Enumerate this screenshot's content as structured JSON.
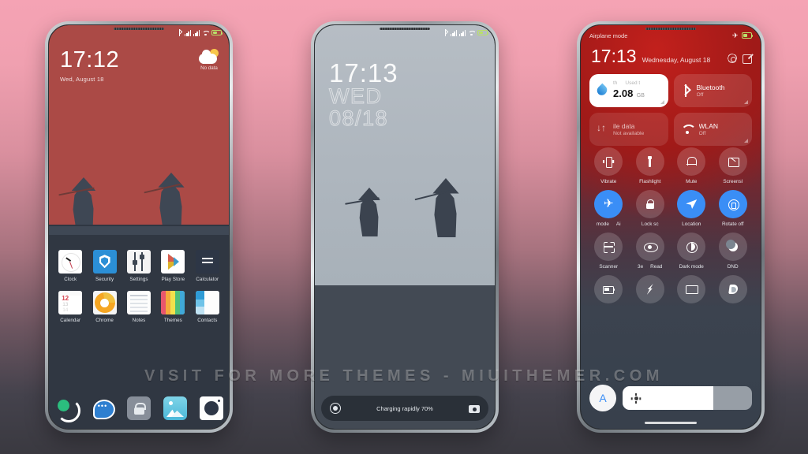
{
  "background": {
    "top_color": "#f5a3b4",
    "bottom_color": "#3a3940"
  },
  "watermark": {
    "text": "VISIT  FOR  MORE  THEMES  -  MIUITHEMER.COM"
  },
  "phone1": {
    "name": "home-screen",
    "statusbar": {
      "icons": [
        "bluetooth-icon",
        "signal-icon",
        "signal-icon",
        "wifi-icon",
        "battery-icon"
      ]
    },
    "clock_widget": {
      "time": "17:12",
      "date": "Wed, August 18"
    },
    "weather_widget": {
      "icon": "partly-cloudy-icon",
      "label": "No data"
    },
    "apps": [
      {
        "label": "Clock",
        "icon": "clock-icon"
      },
      {
        "label": "Security",
        "icon": "shield-icon"
      },
      {
        "label": "Settings",
        "icon": "sliders-icon"
      },
      {
        "label": "Play Store",
        "icon": "play-store-icon"
      },
      {
        "label": "Calculator",
        "icon": "calculator-icon"
      },
      {
        "label": "Calendar",
        "icon": "calendar-icon"
      },
      {
        "label": "Chrome",
        "icon": "chrome-icon"
      },
      {
        "label": "Notes",
        "icon": "notes-icon"
      },
      {
        "label": "Themes",
        "icon": "themes-icon"
      },
      {
        "label": "Contacts",
        "icon": "contacts-icon"
      }
    ],
    "calendar_icon": {
      "day": "12",
      "next1": "13",
      "next2": "14"
    },
    "dock": [
      {
        "name": "phone-app",
        "icon": "phone-icon"
      },
      {
        "name": "messaging-app",
        "icon": "message-icon"
      },
      {
        "name": "lock-app",
        "icon": "lock-icon"
      },
      {
        "name": "gallery-app",
        "icon": "gallery-icon"
      },
      {
        "name": "camera-app",
        "icon": "camera-icon"
      }
    ]
  },
  "phone2": {
    "name": "lock-screen",
    "statusbar": {
      "icons": [
        "bluetooth-icon",
        "signal-icon",
        "signal-icon",
        "wifi-icon",
        "battery-icon"
      ]
    },
    "lock_clock": {
      "time": "17:13",
      "weekday": "WED",
      "date": "08/18"
    },
    "bottom_bar": {
      "left_icon": "flashlight-icon",
      "status_text": "Charging rapidly 70%",
      "right_icon": "camera-icon"
    }
  },
  "phone3": {
    "name": "control-center",
    "statusbar": {
      "left_text": "Airplane mode",
      "icons": [
        "airplane-icon",
        "battery-icon"
      ]
    },
    "header": {
      "time": "17:13",
      "date": "Wednesday, August 18",
      "settings_icon": "gear-icon",
      "edit_icon": "edit-icon"
    },
    "big_tiles": [
      {
        "id": "data-usage",
        "state": "on",
        "icon": "water-drop-icon",
        "used_label": "Used t",
        "mini_label": "th",
        "value": "2.08",
        "unit": "GB"
      },
      {
        "id": "bluetooth",
        "state": "off",
        "icon": "bluetooth-icon",
        "title": "Bluetooth",
        "subtitle": "Off"
      },
      {
        "id": "mobile-data",
        "state": "disabled",
        "icon": "data-transfer-icon",
        "title": "ile data",
        "subtitle": "Not available"
      },
      {
        "id": "wlan",
        "state": "off",
        "icon": "wifi-icon",
        "title": "WLAN",
        "subtitle": "Off"
      }
    ],
    "toggles": [
      {
        "label": "Vibrate",
        "icon": "vibrate-icon",
        "active": false
      },
      {
        "label": "Flashlight",
        "icon": "flashlight-icon",
        "active": false
      },
      {
        "label": "Mute",
        "icon": "bell-icon",
        "active": false
      },
      {
        "label": "Screensl",
        "icon": "screenshot-icon",
        "active": false
      },
      {
        "label": "mode",
        "label2": "Ai",
        "icon": "airplane-icon",
        "active": true
      },
      {
        "label": "Lock sc",
        "icon": "lock-icon",
        "active": false
      },
      {
        "label": "Location",
        "icon": "location-icon",
        "active": true
      },
      {
        "label": "Rotate off",
        "icon": "rotate-icon",
        "active": true
      },
      {
        "label": "Scanner",
        "icon": "scanner-icon",
        "active": false
      },
      {
        "label": "3e",
        "label2": "Read",
        "icon": "eye-icon",
        "active": false
      },
      {
        "label": "Dark mode",
        "icon": "contrast-circle-icon",
        "active": false
      },
      {
        "label": "DND",
        "icon": "moon-icon",
        "active": false
      },
      {
        "label": "",
        "icon": "battery-saver-icon",
        "active": false
      },
      {
        "label": "",
        "icon": "lightning-icon",
        "active": false
      },
      {
        "label": "",
        "icon": "cast-icon",
        "active": false
      },
      {
        "label": "",
        "icon": "reading-mode-icon",
        "active": false
      }
    ],
    "brightness": {
      "auto_label": "A",
      "sun_icon": "brightness-icon",
      "level_percent": 70
    }
  }
}
